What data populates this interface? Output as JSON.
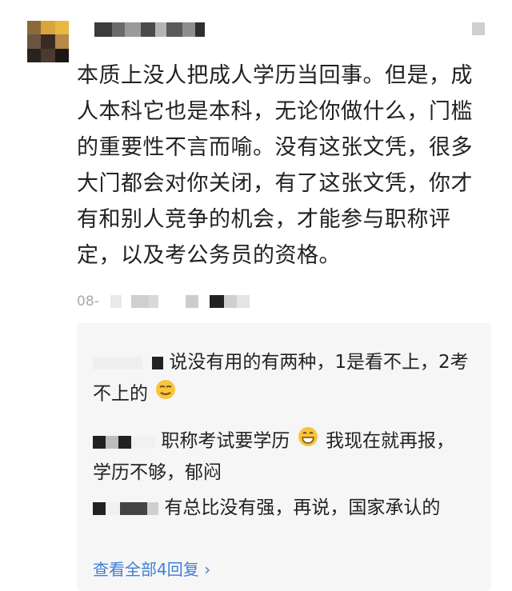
{
  "post": {
    "text": "本质上没人把成人学历当回事。但是，成人本科它也是本科，无论你做什么，门槛的重要性不言而喻。没有这张文凭，很多大门都会对你关闭，有了这张文凭，你才有和别人竞争的机会，才能参与职称评定，以及考公务员的资格。",
    "date": "08-"
  },
  "replies": [
    {
      "text": "说没有用的有两种，1是看不上，2考不上的",
      "emoji": "smirk-emoji"
    },
    {
      "text_before": "职称考试要学历",
      "emoji": "grin-emoji",
      "text_after": "我现在就再报，学历不够，郁闷"
    },
    {
      "text": "有总比没有强，再说，国家承认的"
    }
  ],
  "see_all_label": "查看全部4回复 ›",
  "colors": {
    "link": "#3d7fd6",
    "reply_bg": "#f6f6f6",
    "meta": "#aaaaaa"
  }
}
